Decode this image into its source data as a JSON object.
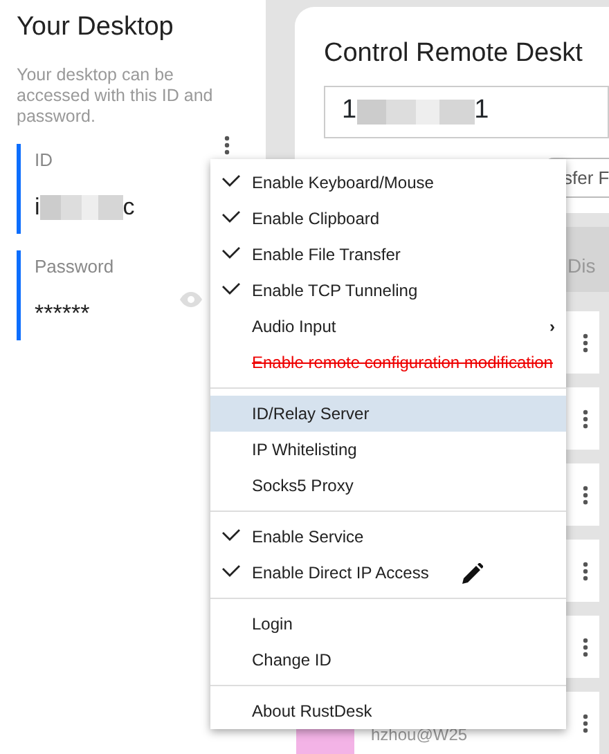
{
  "left_panel": {
    "title": "Your Desktop",
    "description": "Your desktop can be accessed with this ID and password.",
    "id_field": {
      "label": "ID",
      "value_start": "i",
      "value_end": "c"
    },
    "password_field": {
      "label": "Password",
      "value": "******"
    }
  },
  "remote_card": {
    "title": "Control Remote Deskt",
    "id_value_start": "1",
    "id_value_end": "1",
    "button": "sfer F"
  },
  "tabs": [
    {
      "label": "Dis"
    }
  ],
  "peers": [
    {
      "kind": "card"
    },
    {
      "kind": "card"
    },
    {
      "kind": "card"
    },
    {
      "kind": "card"
    },
    {
      "kind": "card"
    },
    {
      "kind": "card",
      "name": "hzhou@W25"
    }
  ],
  "menu": [
    {
      "kind": "item",
      "label": "Enable Keyboard/Mouse",
      "checked": true,
      "selected": false
    },
    {
      "kind": "item",
      "label": "Enable Clipboard",
      "checked": true,
      "selected": false
    },
    {
      "kind": "item",
      "label": "Enable File Transfer",
      "checked": true,
      "selected": false
    },
    {
      "kind": "item",
      "label": "Enable TCP Tunneling",
      "checked": true,
      "selected": false
    },
    {
      "kind": "submenu",
      "label": "Audio Input",
      "arrow": "›",
      "checked": false,
      "selected": false
    },
    {
      "kind": "struck",
      "label": "Enable remote configuration modification",
      "checked": false,
      "selected": false
    },
    {
      "kind": "divider"
    },
    {
      "kind": "item",
      "label": "ID/Relay Server",
      "checked": false,
      "selected": true
    },
    {
      "kind": "item",
      "label": "IP Whitelisting",
      "checked": false,
      "selected": false
    },
    {
      "kind": "item",
      "label": "Socks5 Proxy",
      "checked": false,
      "selected": false
    },
    {
      "kind": "divider"
    },
    {
      "kind": "item",
      "label": "Enable Service",
      "checked": true,
      "selected": false
    },
    {
      "kind": "editable",
      "label": "Enable Direct IP Access",
      "checked": true,
      "selected": false
    },
    {
      "kind": "divider"
    },
    {
      "kind": "item",
      "label": "Login",
      "checked": false,
      "selected": false
    },
    {
      "kind": "item",
      "label": "Change ID",
      "checked": false,
      "selected": false
    },
    {
      "kind": "divider"
    },
    {
      "kind": "item",
      "label": "About RustDesk",
      "checked": false,
      "selected": false
    }
  ]
}
